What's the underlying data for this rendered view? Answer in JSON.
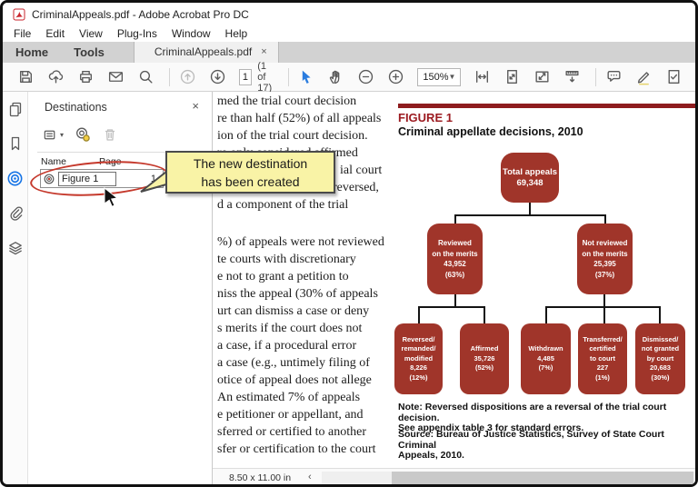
{
  "window": {
    "title": "CriminalAppeals.pdf - Adobe Acrobat Pro DC"
  },
  "menubar": {
    "items": [
      "File",
      "Edit",
      "View",
      "Plug-Ins",
      "Window",
      "Help"
    ]
  },
  "tabbar": {
    "home": "Home",
    "tools": "Tools",
    "document_tab": "CriminalAppeals.pdf",
    "close": "×"
  },
  "toolbar": {
    "page_number": "1",
    "page_count": "(1 of 17)",
    "zoom_level": "150%",
    "zoom_caret": "▼"
  },
  "panel": {
    "title": "Destinations",
    "close": "×",
    "options_caret": "▾",
    "name_column": "Name",
    "page_column": "Page",
    "destination": {
      "name": "Figure 1",
      "page": "1"
    }
  },
  "callout": {
    "text": "The new destination\nhas been created"
  },
  "doc": {
    "para1": [
      "med the trial court decision",
      "re than half (52%) of all appeals",
      "ion of the trial court decision.",
      "re only considered affirmed",
      "ial court",
      "reversed,",
      "d a component of the trial"
    ],
    "para2": [
      "%) of appeals were not reviewed",
      "te courts with discretionary",
      "e not to grant a petition to",
      "niss the appeal (30% of appeals",
      "urt can dismiss a case or deny",
      "s merits if the court does not",
      "a case, if a procedural error",
      "a case (e.g., untimely filing of",
      "otice of appeal does not allege",
      "An estimated 7% of appeals",
      "e petitioner or appellant, and",
      "sferred or certified to another",
      "sfer or certification to the court"
    ],
    "figure": {
      "heading": "FIGURE 1",
      "title": "Criminal appellate decisions, 2010",
      "nodes": {
        "root": "Total appeals\n69,348",
        "reviewed": "Reviewed\non the merits\n43,952\n(63%)",
        "not_reviewed": "Not reviewed\non the merits\n25,395\n(37%)",
        "reversed": "Reversed/\nremanded/\nmodified\n8,226\n(12%)",
        "affirmed": "Affirmed\n35,726\n(52%)",
        "withdrawn": "Withdrawn\n4,485\n(7%)",
        "transferred": "Transferred/\ncertified\nto court\n227\n(1%)",
        "dismissed": "Dismissed/\nnot granted\nby court\n20,683\n(30%)"
      },
      "note": "Note: Reversed dispositions are a reversal of the trial court decision.\nSee appendix table 3 for standard errors.",
      "source": "Source: Bureau of Justice Statistics, Survey of State Court Criminal\nAppeals, 2010."
    }
  },
  "statusbar": {
    "page_size": "8.50 x 11.00 in",
    "scroll_left_arrow": "‹"
  },
  "colors": {
    "accent_blue": "#1473e6",
    "figure_box_red": "#a0352a",
    "figure_bar_red": "#8e1c1e",
    "callout_yellow": "#f9f3a6",
    "annotation_red": "#c5392c"
  },
  "chart_data": {
    "type": "tree",
    "title": "Criminal appellate decisions, 2010",
    "root": {
      "label": "Total appeals",
      "value": 69348,
      "children": [
        {
          "label": "Reviewed on the merits",
          "value": 43952,
          "percent": "63%",
          "children": [
            {
              "label": "Reversed/remanded/modified",
              "value": 8226,
              "percent": "12%"
            },
            {
              "label": "Affirmed",
              "value": 35726,
              "percent": "52%"
            }
          ]
        },
        {
          "label": "Not reviewed on the merits",
          "value": 25395,
          "percent": "37%",
          "children": [
            {
              "label": "Withdrawn",
              "value": 4485,
              "percent": "7%"
            },
            {
              "label": "Transferred/certified to court",
              "value": 227,
              "percent": "1%"
            },
            {
              "label": "Dismissed/not granted by court",
              "value": 20683,
              "percent": "30%"
            }
          ]
        }
      ]
    }
  }
}
